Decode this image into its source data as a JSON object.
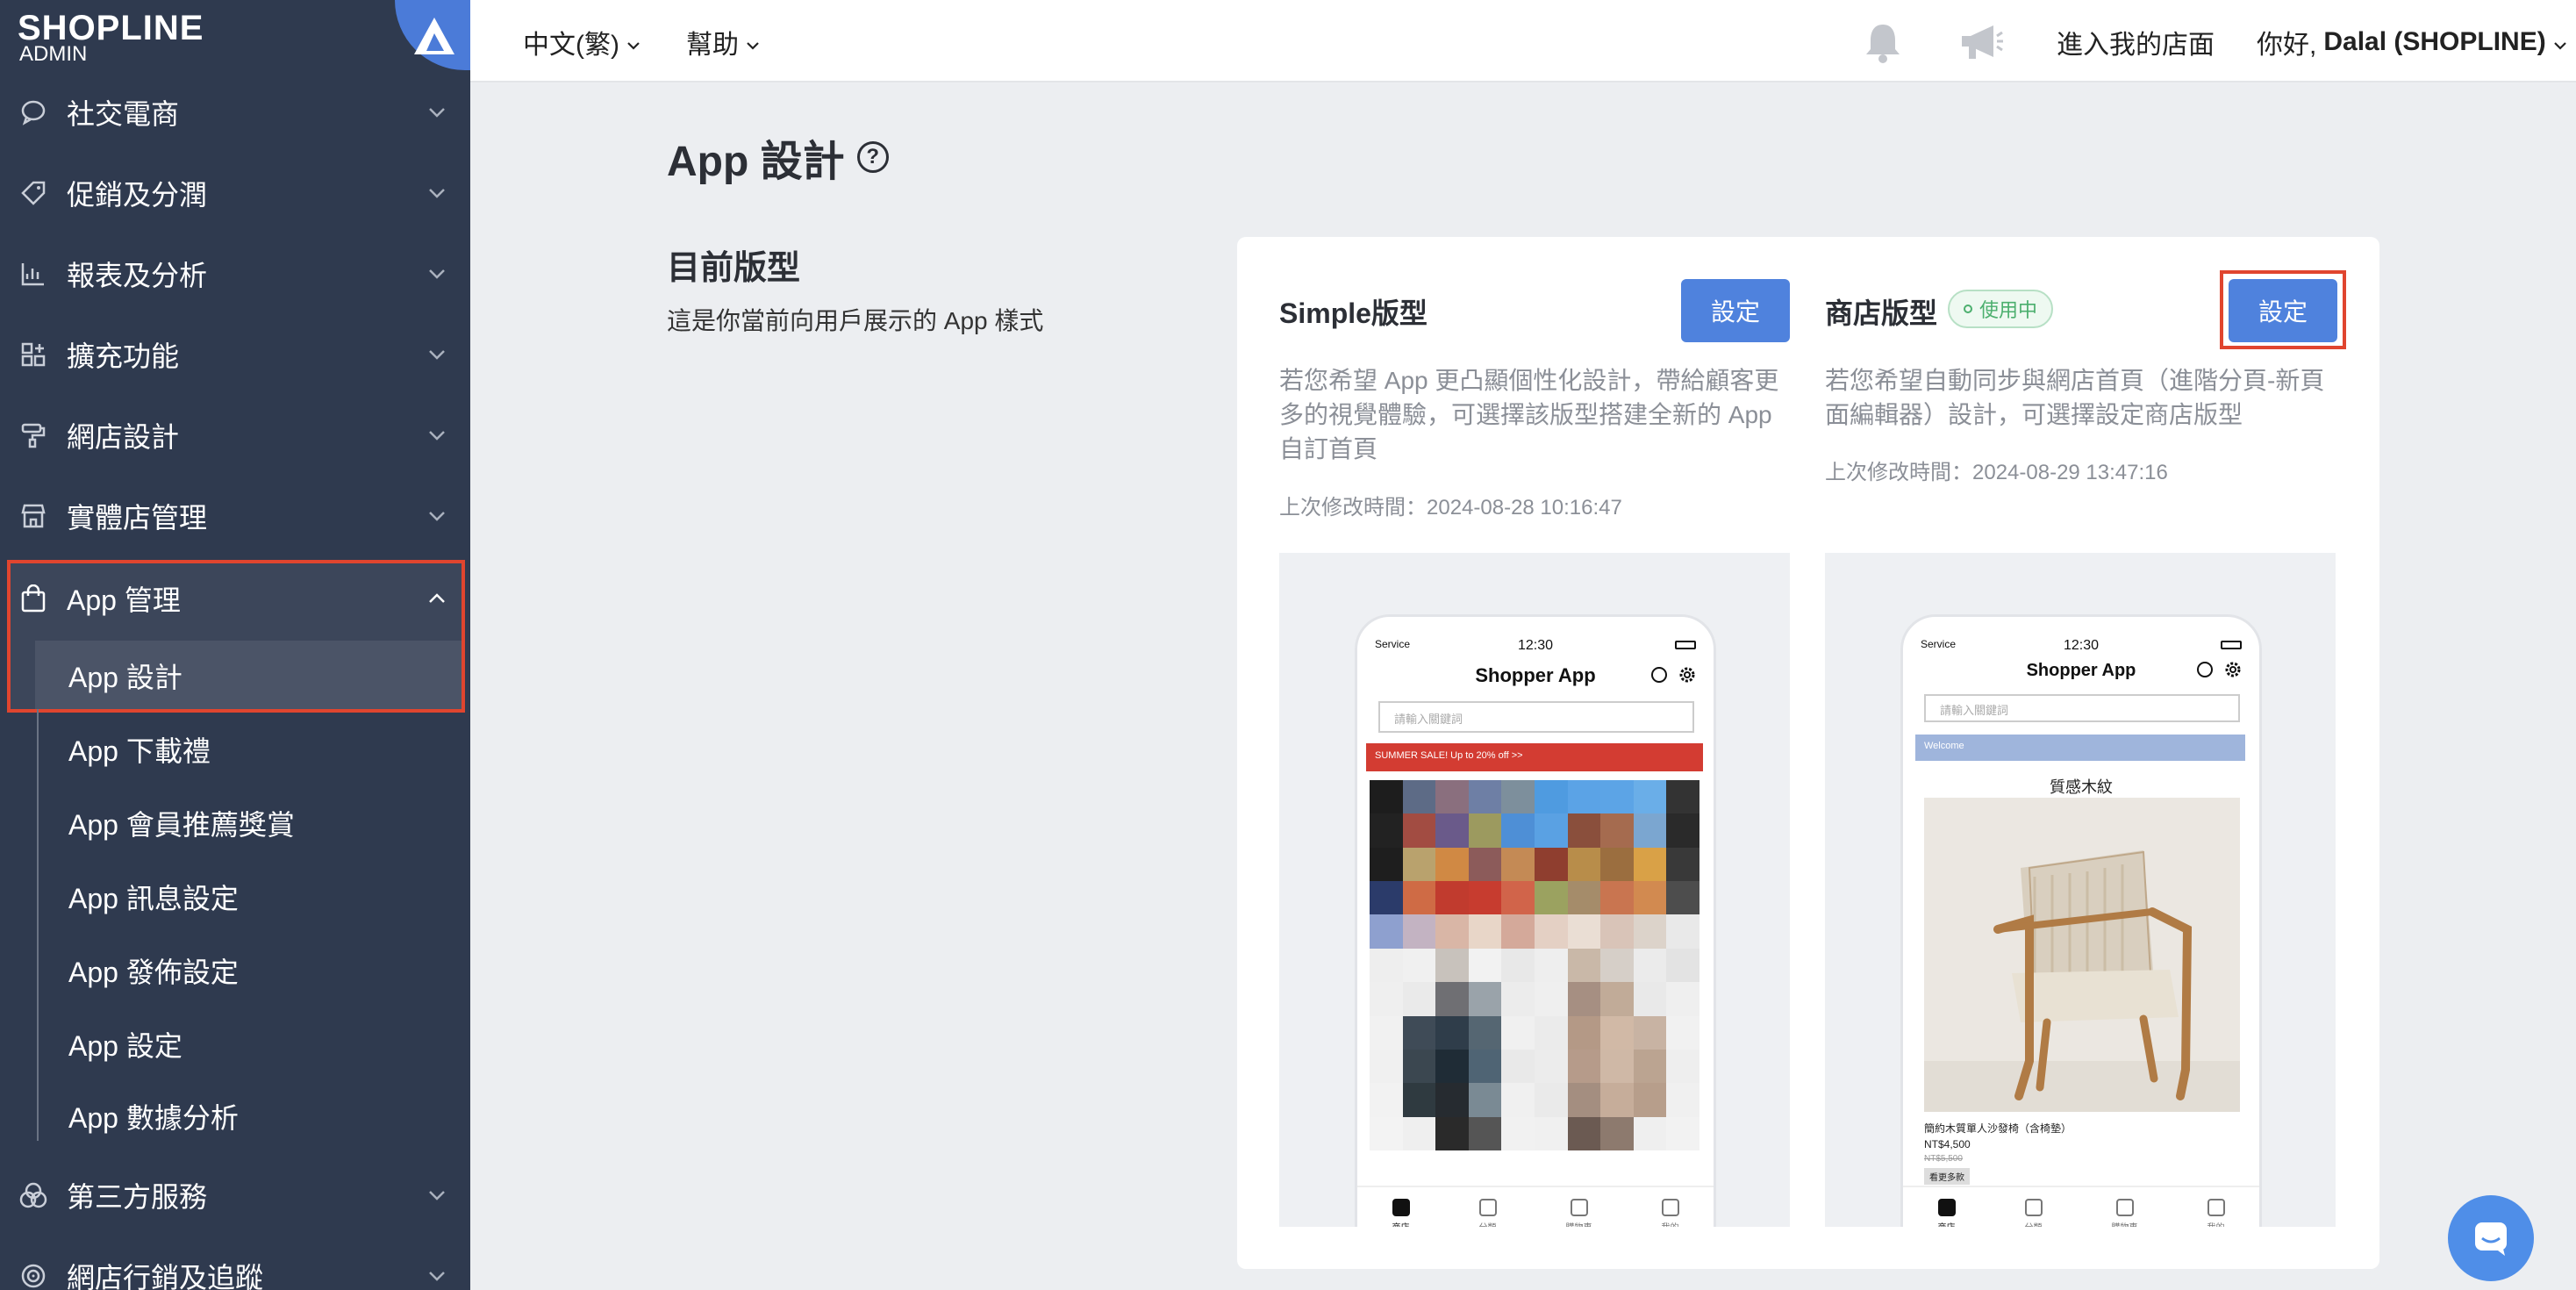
{
  "brand": {
    "name": "SHOPLINE",
    "sub": "ADMIN"
  },
  "sidebar": {
    "items": [
      {
        "label": "社交電商",
        "icon": "chat-bubble-icon"
      },
      {
        "label": "促銷及分潤",
        "icon": "tag-icon"
      },
      {
        "label": "報表及分析",
        "icon": "chart-icon"
      },
      {
        "label": "擴充功能",
        "icon": "grid-plus-icon"
      },
      {
        "label": "網店設計",
        "icon": "paint-roller-icon"
      },
      {
        "label": "實體店管理",
        "icon": "store-icon"
      },
      {
        "label": "App 管理",
        "icon": "shopping-bag-icon"
      },
      {
        "label": "第三方服務",
        "icon": "circles-icon"
      },
      {
        "label": "網店行銷及追蹤",
        "icon": "target-icon"
      }
    ],
    "app_sub": [
      "App 設計",
      "App 下載禮",
      "App 會員推薦獎賞",
      "App 訊息設定",
      "App 發佈設定",
      "App 設定",
      "App 數據分析"
    ]
  },
  "topbar": {
    "language": "中文(繁)",
    "help": "幫助",
    "store_link": "進入我的店面",
    "greeting": "你好,",
    "user": "Dalal (SHOPLINE)"
  },
  "page": {
    "title": "App 設計",
    "section_title": "目前版型",
    "section_desc": "這是你當前向用戶展示的 App 樣式"
  },
  "templates": {
    "simple": {
      "name": "Simple版型",
      "button": "設定",
      "desc": "若您希望 App 更凸顯個性化設計，帶給顧客更多的視覺體驗，可選擇該版型搭建全新的 App 自訂首頁",
      "modified": "上次修改時間：2024-08-28 10:16:47"
    },
    "store": {
      "name": "商店版型",
      "badge": "使用中",
      "button": "設定",
      "desc": "若您希望自動同步與網店首頁（進階分頁-新頁面編輯器）設計，可選擇設定商店版型",
      "modified": "上次修改時間：2024-08-29 13:47:16"
    }
  },
  "phone": {
    "service": "Service",
    "time": "12:30",
    "app_title": "Shopper App",
    "search_placeholder": "請輸入關鍵詞",
    "banner": "SUMMER SALE! Up to 20% off >>",
    "welcome": "Welcome",
    "collection": "質感木紋",
    "product_name": "簡約木質單人沙發椅（含椅墊）",
    "price": "NT$4,500",
    "old_price": "NT$5,500",
    "tag": "看更多款",
    "tabs": [
      "商店",
      "分類",
      "購物車",
      "我的"
    ]
  },
  "colors": {
    "sidebar_bg": "#2f3a4f",
    "primary": "#4f82dd",
    "highlight": "#e0452f",
    "badge_green": "#4caf6e"
  }
}
